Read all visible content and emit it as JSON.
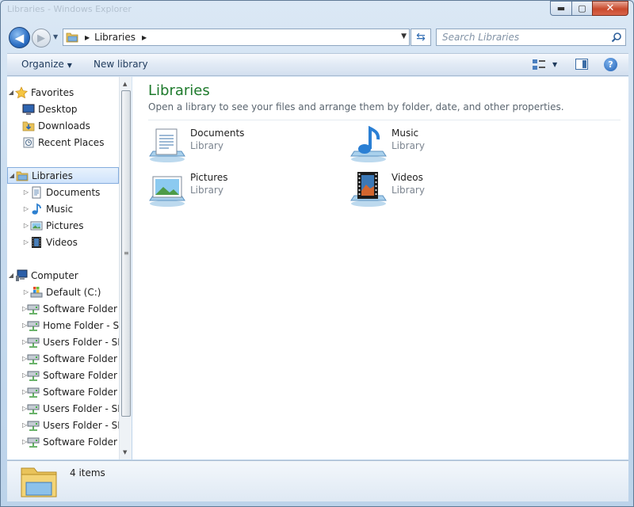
{
  "window": {
    "ghost_title": "Libraries - Windows Explorer",
    "minimize_glyph": "▬",
    "maximize_glyph": "▢",
    "close_glyph": "✕"
  },
  "address": {
    "crumb": "Libraries",
    "back_glyph": "◀",
    "forward_glyph": "▶",
    "recent_glyph": "▼",
    "dropdown_glyph": "▼",
    "refresh_glyph": "⇆",
    "search_placeholder": "Search Libraries"
  },
  "toolbar": {
    "organize_label": "Organize",
    "new_library_label": "New library",
    "help_glyph": "?"
  },
  "nav": {
    "favorites": {
      "label": "Favorites",
      "items": [
        "Desktop",
        "Downloads",
        "Recent Places"
      ]
    },
    "libraries": {
      "label": "Libraries",
      "items": [
        "Documents",
        "Music",
        "Pictures",
        "Videos"
      ]
    },
    "computer": {
      "label": "Computer",
      "items": [
        "Default (C:)",
        "Software Folder - SN",
        "Home Folder - SN",
        "Users Folder - SN",
        "Software Folder - SN",
        "Software Folder - SN",
        "Software Folder - SN",
        "Users Folder - SN",
        "Users Folder - SN",
        "Software Folder - SN"
      ]
    }
  },
  "content": {
    "title": "Libraries",
    "subtitle": "Open a library to see your files and arrange them by folder, date, and other properties.",
    "libraries": [
      {
        "name": "Documents",
        "kind": "Library",
        "icon": "documents-library-icon"
      },
      {
        "name": "Music",
        "kind": "Library",
        "icon": "music-library-icon"
      },
      {
        "name": "Pictures",
        "kind": "Library",
        "icon": "pictures-library-icon"
      },
      {
        "name": "Videos",
        "kind": "Library",
        "icon": "videos-library-icon"
      }
    ]
  },
  "details": {
    "item_count": "4 items"
  },
  "colors": {
    "title_green": "#1e7a2c",
    "selection_blue": "#cfe3fb",
    "chrome_blue": "#c9dcef"
  }
}
